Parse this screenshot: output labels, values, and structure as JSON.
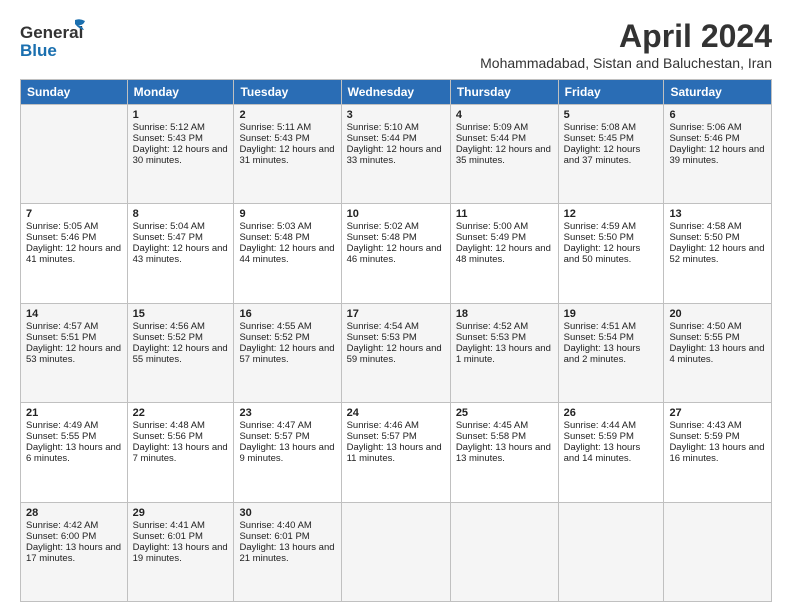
{
  "header": {
    "logo_general": "General",
    "logo_blue": "Blue",
    "month": "April 2024",
    "location": "Mohammadabad, Sistan and Baluchestan, Iran"
  },
  "days_of_week": [
    "Sunday",
    "Monday",
    "Tuesday",
    "Wednesday",
    "Thursday",
    "Friday",
    "Saturday"
  ],
  "weeks": [
    [
      {
        "num": "",
        "sunrise": "",
        "sunset": "",
        "daylight": ""
      },
      {
        "num": "1",
        "sunrise": "Sunrise: 5:12 AM",
        "sunset": "Sunset: 5:43 PM",
        "daylight": "Daylight: 12 hours and 30 minutes."
      },
      {
        "num": "2",
        "sunrise": "Sunrise: 5:11 AM",
        "sunset": "Sunset: 5:43 PM",
        "daylight": "Daylight: 12 hours and 31 minutes."
      },
      {
        "num": "3",
        "sunrise": "Sunrise: 5:10 AM",
        "sunset": "Sunset: 5:44 PM",
        "daylight": "Daylight: 12 hours and 33 minutes."
      },
      {
        "num": "4",
        "sunrise": "Sunrise: 5:09 AM",
        "sunset": "Sunset: 5:44 PM",
        "daylight": "Daylight: 12 hours and 35 minutes."
      },
      {
        "num": "5",
        "sunrise": "Sunrise: 5:08 AM",
        "sunset": "Sunset: 5:45 PM",
        "daylight": "Daylight: 12 hours and 37 minutes."
      },
      {
        "num": "6",
        "sunrise": "Sunrise: 5:06 AM",
        "sunset": "Sunset: 5:46 PM",
        "daylight": "Daylight: 12 hours and 39 minutes."
      }
    ],
    [
      {
        "num": "7",
        "sunrise": "Sunrise: 5:05 AM",
        "sunset": "Sunset: 5:46 PM",
        "daylight": "Daylight: 12 hours and 41 minutes."
      },
      {
        "num": "8",
        "sunrise": "Sunrise: 5:04 AM",
        "sunset": "Sunset: 5:47 PM",
        "daylight": "Daylight: 12 hours and 43 minutes."
      },
      {
        "num": "9",
        "sunrise": "Sunrise: 5:03 AM",
        "sunset": "Sunset: 5:48 PM",
        "daylight": "Daylight: 12 hours and 44 minutes."
      },
      {
        "num": "10",
        "sunrise": "Sunrise: 5:02 AM",
        "sunset": "Sunset: 5:48 PM",
        "daylight": "Daylight: 12 hours and 46 minutes."
      },
      {
        "num": "11",
        "sunrise": "Sunrise: 5:00 AM",
        "sunset": "Sunset: 5:49 PM",
        "daylight": "Daylight: 12 hours and 48 minutes."
      },
      {
        "num": "12",
        "sunrise": "Sunrise: 4:59 AM",
        "sunset": "Sunset: 5:50 PM",
        "daylight": "Daylight: 12 hours and 50 minutes."
      },
      {
        "num": "13",
        "sunrise": "Sunrise: 4:58 AM",
        "sunset": "Sunset: 5:50 PM",
        "daylight": "Daylight: 12 hours and 52 minutes."
      }
    ],
    [
      {
        "num": "14",
        "sunrise": "Sunrise: 4:57 AM",
        "sunset": "Sunset: 5:51 PM",
        "daylight": "Daylight: 12 hours and 53 minutes."
      },
      {
        "num": "15",
        "sunrise": "Sunrise: 4:56 AM",
        "sunset": "Sunset: 5:52 PM",
        "daylight": "Daylight: 12 hours and 55 minutes."
      },
      {
        "num": "16",
        "sunrise": "Sunrise: 4:55 AM",
        "sunset": "Sunset: 5:52 PM",
        "daylight": "Daylight: 12 hours and 57 minutes."
      },
      {
        "num": "17",
        "sunrise": "Sunrise: 4:54 AM",
        "sunset": "Sunset: 5:53 PM",
        "daylight": "Daylight: 12 hours and 59 minutes."
      },
      {
        "num": "18",
        "sunrise": "Sunrise: 4:52 AM",
        "sunset": "Sunset: 5:53 PM",
        "daylight": "Daylight: 13 hours and 1 minute."
      },
      {
        "num": "19",
        "sunrise": "Sunrise: 4:51 AM",
        "sunset": "Sunset: 5:54 PM",
        "daylight": "Daylight: 13 hours and 2 minutes."
      },
      {
        "num": "20",
        "sunrise": "Sunrise: 4:50 AM",
        "sunset": "Sunset: 5:55 PM",
        "daylight": "Daylight: 13 hours and 4 minutes."
      }
    ],
    [
      {
        "num": "21",
        "sunrise": "Sunrise: 4:49 AM",
        "sunset": "Sunset: 5:55 PM",
        "daylight": "Daylight: 13 hours and 6 minutes."
      },
      {
        "num": "22",
        "sunrise": "Sunrise: 4:48 AM",
        "sunset": "Sunset: 5:56 PM",
        "daylight": "Daylight: 13 hours and 7 minutes."
      },
      {
        "num": "23",
        "sunrise": "Sunrise: 4:47 AM",
        "sunset": "Sunset: 5:57 PM",
        "daylight": "Daylight: 13 hours and 9 minutes."
      },
      {
        "num": "24",
        "sunrise": "Sunrise: 4:46 AM",
        "sunset": "Sunset: 5:57 PM",
        "daylight": "Daylight: 13 hours and 11 minutes."
      },
      {
        "num": "25",
        "sunrise": "Sunrise: 4:45 AM",
        "sunset": "Sunset: 5:58 PM",
        "daylight": "Daylight: 13 hours and 13 minutes."
      },
      {
        "num": "26",
        "sunrise": "Sunrise: 4:44 AM",
        "sunset": "Sunset: 5:59 PM",
        "daylight": "Daylight: 13 hours and 14 minutes."
      },
      {
        "num": "27",
        "sunrise": "Sunrise: 4:43 AM",
        "sunset": "Sunset: 5:59 PM",
        "daylight": "Daylight: 13 hours and 16 minutes."
      }
    ],
    [
      {
        "num": "28",
        "sunrise": "Sunrise: 4:42 AM",
        "sunset": "Sunset: 6:00 PM",
        "daylight": "Daylight: 13 hours and 17 minutes."
      },
      {
        "num": "29",
        "sunrise": "Sunrise: 4:41 AM",
        "sunset": "Sunset: 6:01 PM",
        "daylight": "Daylight: 13 hours and 19 minutes."
      },
      {
        "num": "30",
        "sunrise": "Sunrise: 4:40 AM",
        "sunset": "Sunset: 6:01 PM",
        "daylight": "Daylight: 13 hours and 21 minutes."
      },
      {
        "num": "",
        "sunrise": "",
        "sunset": "",
        "daylight": ""
      },
      {
        "num": "",
        "sunrise": "",
        "sunset": "",
        "daylight": ""
      },
      {
        "num": "",
        "sunrise": "",
        "sunset": "",
        "daylight": ""
      },
      {
        "num": "",
        "sunrise": "",
        "sunset": "",
        "daylight": ""
      }
    ]
  ]
}
